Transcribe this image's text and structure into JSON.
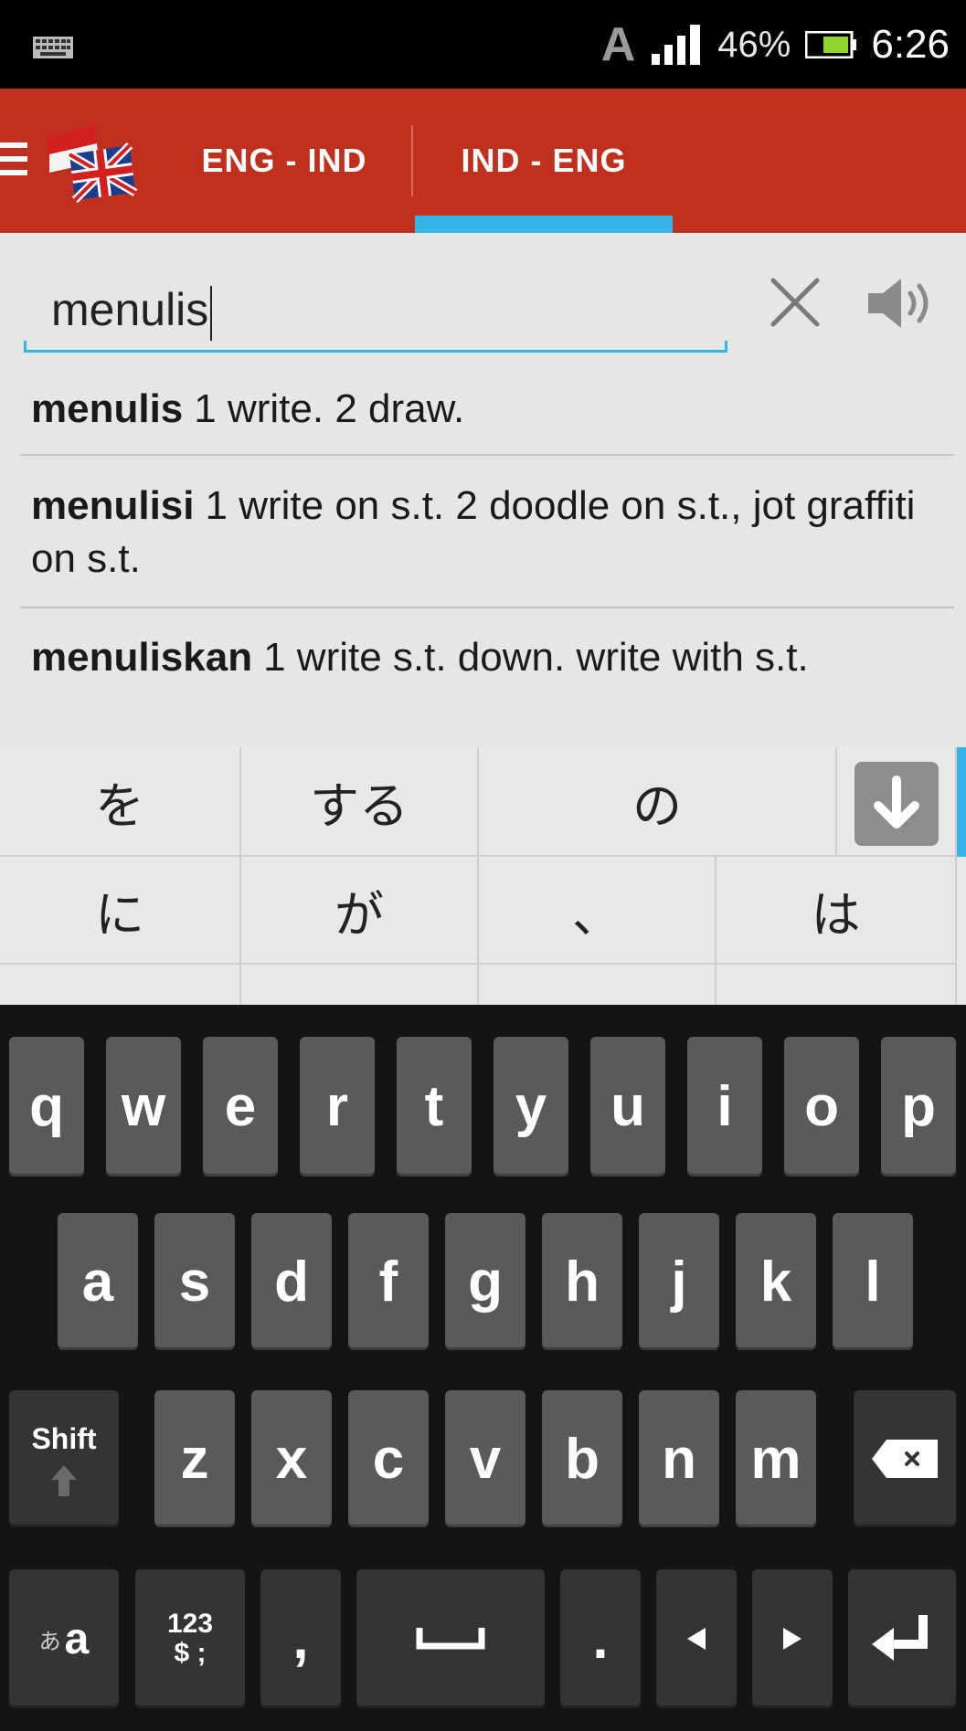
{
  "status_bar": {
    "icons": [
      "keyboard-icon",
      "a-icon",
      "signal-icon",
      "battery-icon"
    ],
    "a_label": "A",
    "battery_percent": "46%",
    "time": "6:26"
  },
  "action_bar": {
    "color": "#c0301e",
    "indicator_color": "#33b5e5",
    "tabs": [
      {
        "label": "ENG - IND",
        "selected": false
      },
      {
        "label": "IND - ENG",
        "selected": true
      }
    ]
  },
  "search": {
    "value": "menulis"
  },
  "results": [
    {
      "word": "menulis",
      "definition": "1 write. 2 draw."
    },
    {
      "word": "menulisi",
      "definition": "1 write on s.t. 2 doodle on s.t., jot graffiti on s.t."
    },
    {
      "word": "menuliskan",
      "definition": "1 write s.t. down. write with s.t."
    }
  ],
  "ime_candidates": {
    "row1": [
      "を",
      "する",
      "の"
    ],
    "row2": [
      "に",
      "が",
      "、",
      "は"
    ]
  },
  "keyboard": {
    "row1": [
      "q",
      "w",
      "e",
      "r",
      "t",
      "y",
      "u",
      "i",
      "o",
      "p"
    ],
    "row2": [
      "a",
      "s",
      "d",
      "f",
      "g",
      "h",
      "j",
      "k",
      "l"
    ],
    "row3": [
      "z",
      "x",
      "c",
      "v",
      "b",
      "n",
      "m"
    ],
    "shift_label": "Shift",
    "lang_small": "あ",
    "lang_label": "a",
    "num_line1": "123",
    "num_line2": "$ ;",
    "comma": ",",
    "period": "."
  }
}
